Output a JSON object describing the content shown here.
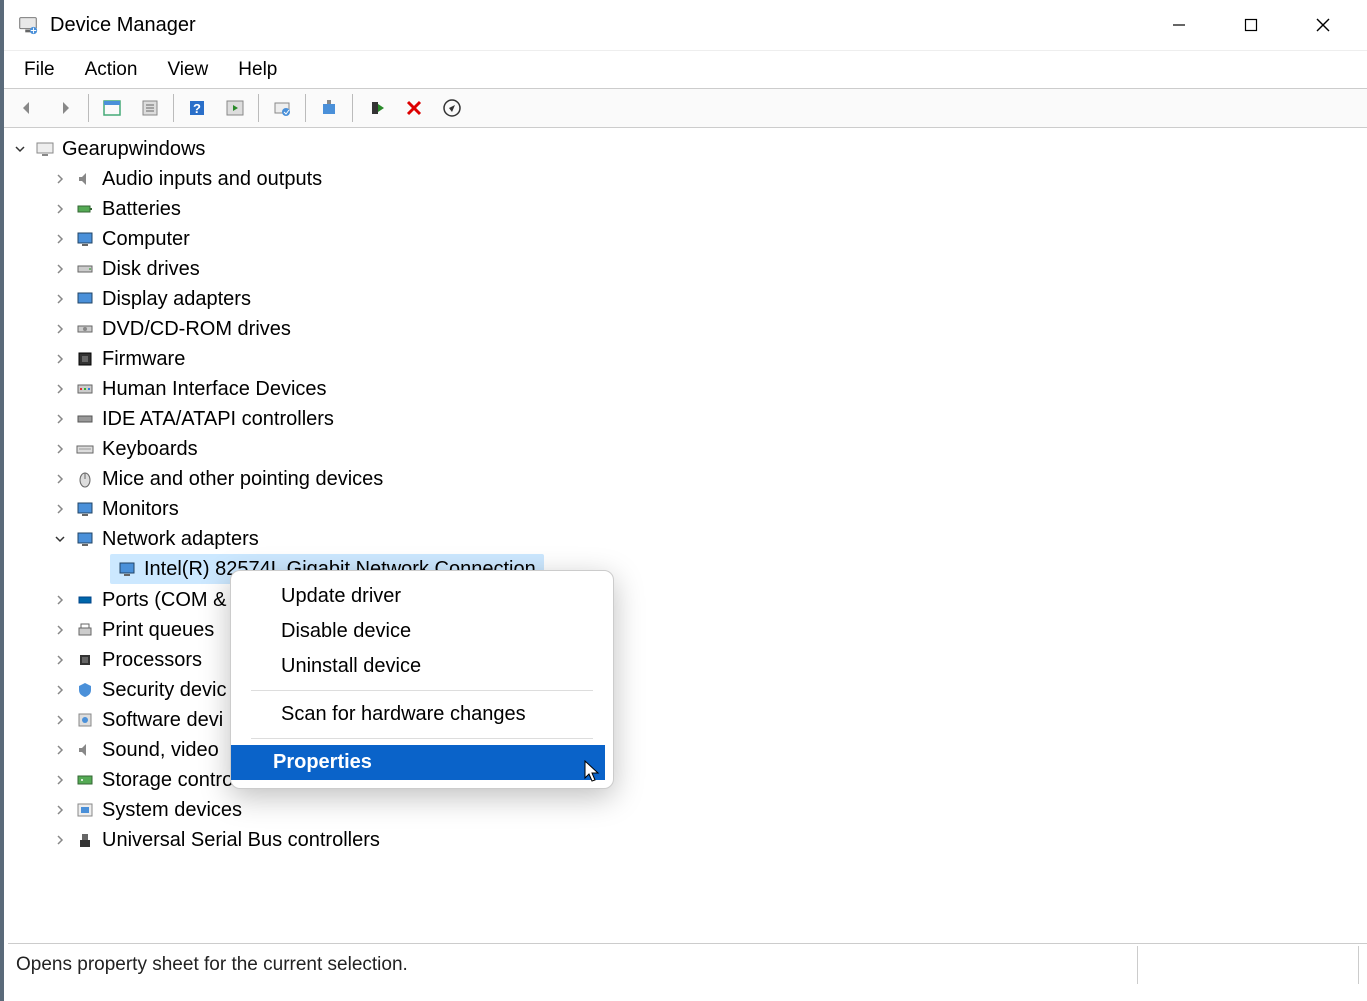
{
  "window": {
    "title": "Device Manager"
  },
  "menubar": {
    "file": "File",
    "action": "Action",
    "view": "View",
    "help": "Help"
  },
  "tree": {
    "root": "Gearupwindows",
    "categories": [
      {
        "label": "Audio inputs and outputs",
        "expanded": false
      },
      {
        "label": "Batteries",
        "expanded": false
      },
      {
        "label": "Computer",
        "expanded": false
      },
      {
        "label": "Disk drives",
        "expanded": false
      },
      {
        "label": "Display adapters",
        "expanded": false
      },
      {
        "label": "DVD/CD-ROM drives",
        "expanded": false
      },
      {
        "label": "Firmware",
        "expanded": false
      },
      {
        "label": "Human Interface Devices",
        "expanded": false
      },
      {
        "label": "IDE ATA/ATAPI controllers",
        "expanded": false
      },
      {
        "label": "Keyboards",
        "expanded": false
      },
      {
        "label": "Mice and other pointing devices",
        "expanded": false
      },
      {
        "label": "Monitors",
        "expanded": false
      },
      {
        "label": "Network adapters",
        "expanded": true,
        "children": [
          {
            "label": "Intel(R) 82574L Gigabit Network Connection",
            "selected": true
          }
        ]
      },
      {
        "label": "Ports (COM &",
        "expanded": false
      },
      {
        "label": "Print queues",
        "expanded": false
      },
      {
        "label": "Processors",
        "expanded": false
      },
      {
        "label": "Security devic",
        "expanded": false
      },
      {
        "label": "Software devi",
        "expanded": false
      },
      {
        "label": "Sound, video",
        "expanded": false
      },
      {
        "label": "Storage contro",
        "expanded": false
      },
      {
        "label": "System devices",
        "expanded": false
      },
      {
        "label": "Universal Serial Bus controllers",
        "expanded": false
      }
    ]
  },
  "context_menu": {
    "update": "Update driver",
    "disable": "Disable device",
    "uninstall": "Uninstall device",
    "scan": "Scan for hardware changes",
    "properties": "Properties"
  },
  "statusbar": {
    "text": "Opens property sheet for the current selection."
  }
}
